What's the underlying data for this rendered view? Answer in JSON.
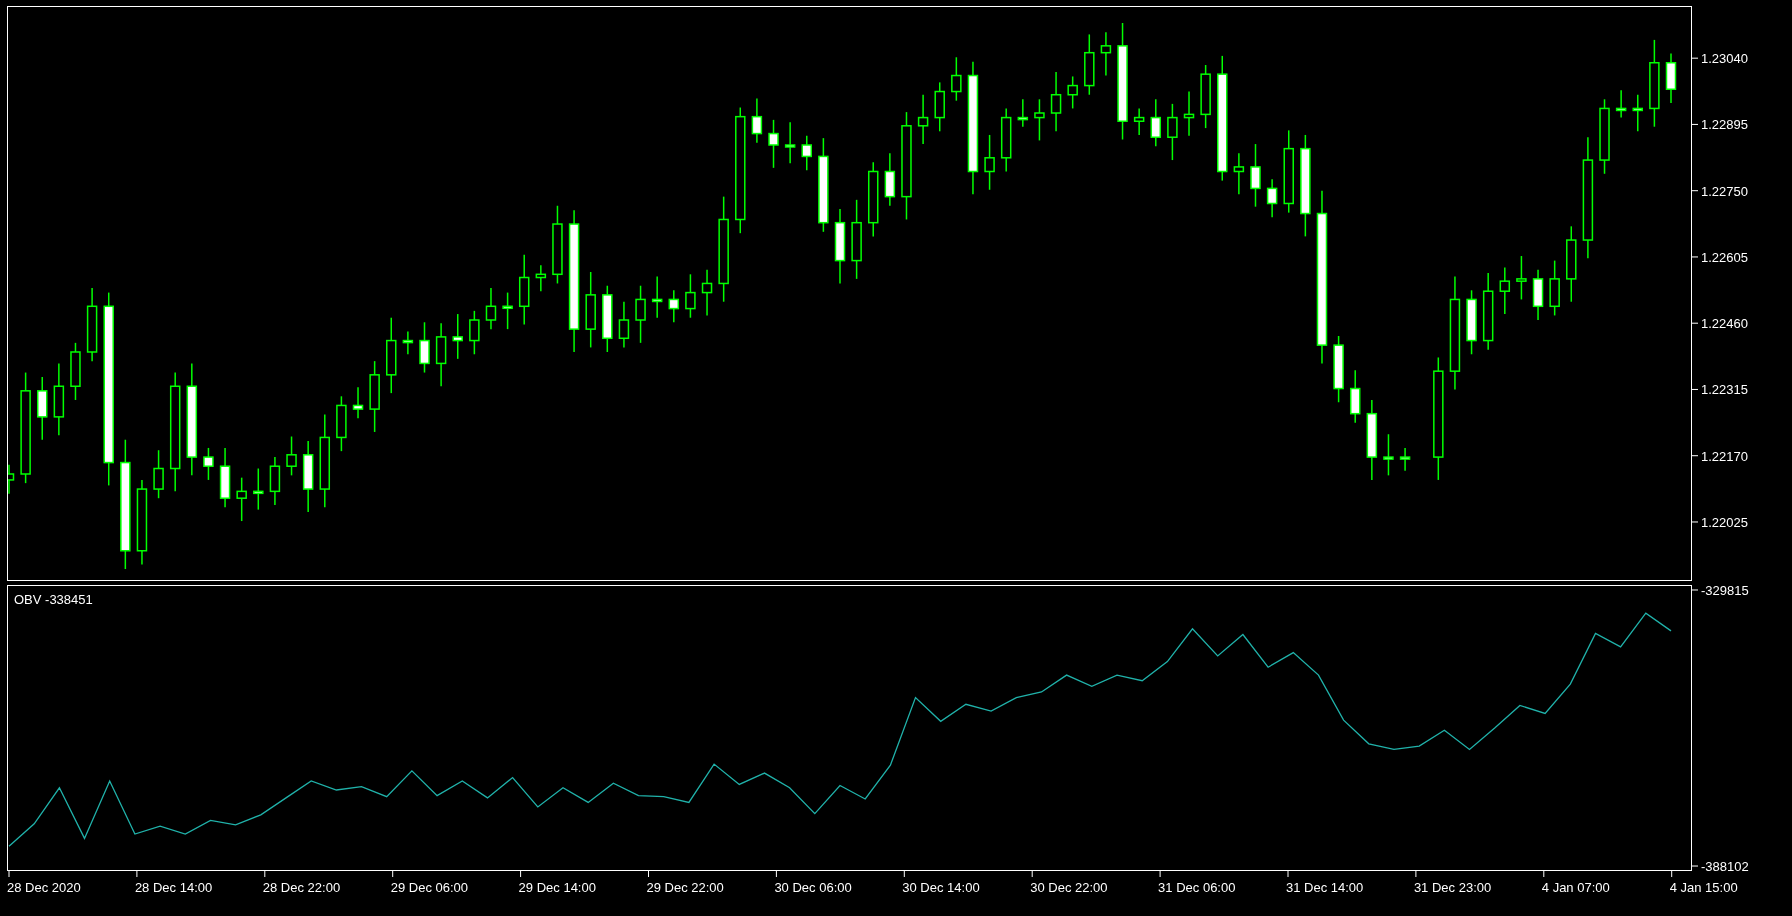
{
  "price_chart": {
    "chart_data": {
      "type": "candlestick",
      "ylim": [
        1.21898,
        1.23152
      ],
      "yticks": [
        {
          "value": 1.2304,
          "label": "1.23040"
        },
        {
          "value": 1.22895,
          "label": "1.22895"
        },
        {
          "value": 1.2275,
          "label": "1.22750"
        },
        {
          "value": 1.22605,
          "label": "1.22605"
        },
        {
          "value": 1.2246,
          "label": "1.22460"
        },
        {
          "value": 1.22315,
          "label": "1.22315"
        },
        {
          "value": 1.2217,
          "label": "1.22170"
        },
        {
          "value": 1.22025,
          "label": "1.22025"
        }
      ],
      "ohlc": [
        [
          1.22117,
          1.2215,
          1.22087,
          1.2213
        ],
        [
          1.2213,
          1.22352,
          1.2211,
          1.22312
        ],
        [
          1.22312,
          1.22342,
          1.22205,
          1.22255
        ],
        [
          1.22255,
          1.22372,
          1.22215,
          1.22322
        ],
        [
          1.22322,
          1.22417,
          1.22292,
          1.22397
        ],
        [
          1.22397,
          1.22537,
          1.22377,
          1.22497
        ],
        [
          1.22497,
          1.22527,
          1.22105,
          1.22155
        ],
        [
          1.22155,
          1.22205,
          1.21922,
          1.21962
        ],
        [
          1.21962,
          1.22117,
          1.21932,
          1.22097
        ],
        [
          1.22097,
          1.22182,
          1.22077,
          1.22142
        ],
        [
          1.22142,
          1.22352,
          1.22092,
          1.22322
        ],
        [
          1.22322,
          1.22372,
          1.22127,
          1.22167
        ],
        [
          1.22167,
          1.22187,
          1.22117,
          1.22147
        ],
        [
          1.22147,
          1.22187,
          1.22057,
          1.22077
        ],
        [
          1.22077,
          1.22122,
          1.22027,
          1.22092
        ],
        [
          1.22092,
          1.22142,
          1.22052,
          1.22092
        ],
        [
          1.22092,
          1.22167,
          1.22062,
          1.22147
        ],
        [
          1.22147,
          1.22212,
          1.22127,
          1.22172
        ],
        [
          1.22172,
          1.22202,
          1.22047,
          1.22097
        ],
        [
          1.22097,
          1.2226,
          1.22057,
          1.2221
        ],
        [
          1.2221,
          1.223,
          1.2218,
          1.2228
        ],
        [
          1.2228,
          1.2232,
          1.22252,
          1.22272
        ],
        [
          1.22272,
          1.22377,
          1.22222,
          1.22347
        ],
        [
          1.22347,
          1.22472,
          1.22307,
          1.22422
        ],
        [
          1.22422,
          1.22442,
          1.22392,
          1.22422
        ],
        [
          1.22422,
          1.22462,
          1.22352,
          1.22372
        ],
        [
          1.22372,
          1.2246,
          1.22322,
          1.2243
        ],
        [
          1.2243,
          1.2248,
          1.22382,
          1.22422
        ],
        [
          1.22422,
          1.22487,
          1.22392,
          1.22467
        ],
        [
          1.22467,
          1.22537,
          1.22447,
          1.22497
        ],
        [
          1.22497,
          1.22527,
          1.22447,
          1.22497
        ],
        [
          1.22497,
          1.2261,
          1.22457,
          1.2256
        ],
        [
          1.2256,
          1.22587,
          1.2253,
          1.22567
        ],
        [
          1.22567,
          1.22717,
          1.22547,
          1.22677
        ],
        [
          1.22677,
          1.22707,
          1.22397,
          1.22447
        ],
        [
          1.22447,
          1.22572,
          1.22407,
          1.22522
        ],
        [
          1.22522,
          1.22542,
          1.22397,
          1.22427
        ],
        [
          1.22427,
          1.22507,
          1.22407,
          1.22467
        ],
        [
          1.22467,
          1.22542,
          1.22417,
          1.22512
        ],
        [
          1.22512,
          1.22562,
          1.22472,
          1.22512
        ],
        [
          1.22512,
          1.22532,
          1.22462,
          1.22492
        ],
        [
          1.22492,
          1.22567,
          1.22472,
          1.22527
        ],
        [
          1.22527,
          1.22577,
          1.22477,
          1.22547
        ],
        [
          1.22547,
          1.22737,
          1.22507,
          1.22687
        ],
        [
          1.22687,
          1.22932,
          1.22657,
          1.22912
        ],
        [
          1.22912,
          1.22952,
          1.22855,
          1.22875
        ],
        [
          1.22875,
          1.22905,
          1.228,
          1.2285
        ],
        [
          1.2285,
          1.229,
          1.2281,
          1.2285
        ],
        [
          1.2285,
          1.2287,
          1.22795,
          1.22825
        ],
        [
          1.22825,
          1.22865,
          1.2266,
          1.2268
        ],
        [
          1.2268,
          1.2271,
          1.22547,
          1.22597
        ],
        [
          1.22597,
          1.2273,
          1.22557,
          1.2268
        ],
        [
          1.2268,
          1.22812,
          1.2265,
          1.22792
        ],
        [
          1.22792,
          1.22832,
          1.22717,
          1.22737
        ],
        [
          1.22737,
          1.22922,
          1.22687,
          1.22892
        ],
        [
          1.22892,
          1.2296,
          1.22852,
          1.2291
        ],
        [
          1.2291,
          1.22987,
          1.2288,
          1.22967
        ],
        [
          1.22967,
          1.23042,
          1.22947,
          1.23002
        ],
        [
          1.23002,
          1.23032,
          1.22742,
          1.22792
        ],
        [
          1.22792,
          1.22872,
          1.22752,
          1.22822
        ],
        [
          1.22822,
          1.2293,
          1.22792,
          1.2291
        ],
        [
          1.2291,
          1.2295,
          1.2289,
          1.2291
        ],
        [
          1.2291,
          1.2295,
          1.2286,
          1.2292
        ],
        [
          1.2292,
          1.2301,
          1.2288,
          1.2296
        ],
        [
          1.2296,
          1.23,
          1.2293,
          1.2298
        ],
        [
          1.2298,
          1.23092,
          1.2296,
          1.23052
        ],
        [
          1.23052,
          1.23097,
          1.23002,
          1.23067
        ],
        [
          1.23067,
          1.23117,
          1.22862,
          1.22902
        ],
        [
          1.22902,
          1.2293,
          1.22872,
          1.2291
        ],
        [
          1.2291,
          1.2295,
          1.22847,
          1.22867
        ],
        [
          1.22867,
          1.2294,
          1.22817,
          1.2291
        ],
        [
          1.2291,
          1.22967,
          1.2287,
          1.22917
        ],
        [
          1.22917,
          1.23025,
          1.22887,
          1.23005
        ],
        [
          1.23005,
          1.23045,
          1.22772,
          1.22792
        ],
        [
          1.22792,
          1.22832,
          1.22742,
          1.22802
        ],
        [
          1.22802,
          1.22852,
          1.22715,
          1.22755
        ],
        [
          1.22755,
          1.22775,
          1.22692,
          1.22722
        ],
        [
          1.22722,
          1.22882,
          1.22702,
          1.22842
        ],
        [
          1.22842,
          1.22872,
          1.2265,
          1.227
        ],
        [
          1.227,
          1.2275,
          1.22372,
          1.22412
        ],
        [
          1.22412,
          1.22432,
          1.22287,
          1.22317
        ],
        [
          1.22317,
          1.22357,
          1.22242,
          1.22262
        ],
        [
          1.22262,
          1.22292,
          1.22117,
          1.22167
        ],
        [
          1.22167,
          1.22217,
          1.22127,
          1.22167
        ],
        [
          1.22167,
          1.22187,
          1.22137,
          1.22167
        ],
        null,
        [
          1.22167,
          1.22385,
          1.22117,
          1.22355
        ],
        [
          1.22355,
          1.22562,
          1.22315,
          1.22512
        ],
        [
          1.22512,
          1.22532,
          1.22392,
          1.22422
        ],
        [
          1.22422,
          1.2257,
          1.22402,
          1.2253
        ],
        [
          1.2253,
          1.22582,
          1.2248,
          1.22552
        ],
        [
          1.22552,
          1.22607,
          1.22512,
          1.22557
        ],
        [
          1.22557,
          1.22577,
          1.22467,
          1.22497
        ],
        [
          1.22497,
          1.22597,
          1.22477,
          1.22557
        ],
        [
          1.22557,
          1.22672,
          1.22507,
          1.22642
        ],
        [
          1.22642,
          1.22867,
          1.22602,
          1.22817
        ],
        [
          1.22817,
          1.2295,
          1.22787,
          1.2293
        ],
        [
          1.2293,
          1.2297,
          1.2291,
          1.2293
        ],
        [
          1.2293,
          1.2296,
          1.2288,
          1.2293
        ],
        [
          1.2293,
          1.2308,
          1.2289,
          1.2303
        ],
        [
          1.2303,
          1.2305,
          1.22942,
          1.22972
        ]
      ]
    }
  },
  "obv_indicator": {
    "value": "-338451",
    "chart_data": {
      "type": "line",
      "ylim": [
        -388941,
        -328976
      ],
      "yticks": [
        {
          "value": -329815,
          "label": "-329815"
        },
        {
          "value": -388102,
          "label": "-388102"
        }
      ],
      "series": [
        {
          "name": "OBV",
          "color": "#20b2aa",
          "values": [
            -383940,
            -379193,
            -371575,
            -382274,
            -370144,
            -381331,
            -379672,
            -381331,
            -378467,
            -379423,
            -377278,
            -373710,
            -370144,
            -372048,
            -371340,
            -373472,
            -368008,
            -373235,
            -370144,
            -373710,
            -369431,
            -375612,
            -371575,
            -374670,
            -370621,
            -373235,
            -373472,
            -374670,
            -366584,
            -370862,
            -368476,
            -371575,
            -377042,
            -371100,
            -373947,
            -366814,
            -352546,
            -357540,
            -353963,
            -355396,
            -352546,
            -351361,
            -347780,
            -350153,
            -347780,
            -348967,
            -344928,
            -338021,
            -343737,
            -339216,
            -346115,
            -343034,
            -347780,
            -357293,
            -362290,
            -363477,
            -362770,
            -359441,
            -363477,
            -358959,
            -354209,
            -355871,
            -349683,
            -338974,
            -341835,
            -334701,
            -338451
          ]
        }
      ]
    }
  },
  "time_axis": {
    "labels": [
      "28 Dec 2020",
      "28 Dec 14:00",
      "28 Dec 22:00",
      "29 Dec 06:00",
      "29 Dec 14:00",
      "29 Dec 22:00",
      "30 Dec 06:00",
      "30 Dec 14:00",
      "30 Dec 22:00",
      "31 Dec 06:00",
      "31 Dec 14:00",
      "31 Dec 23:00",
      "4 Jan 07:00",
      "4 Jan 15:00"
    ]
  }
}
